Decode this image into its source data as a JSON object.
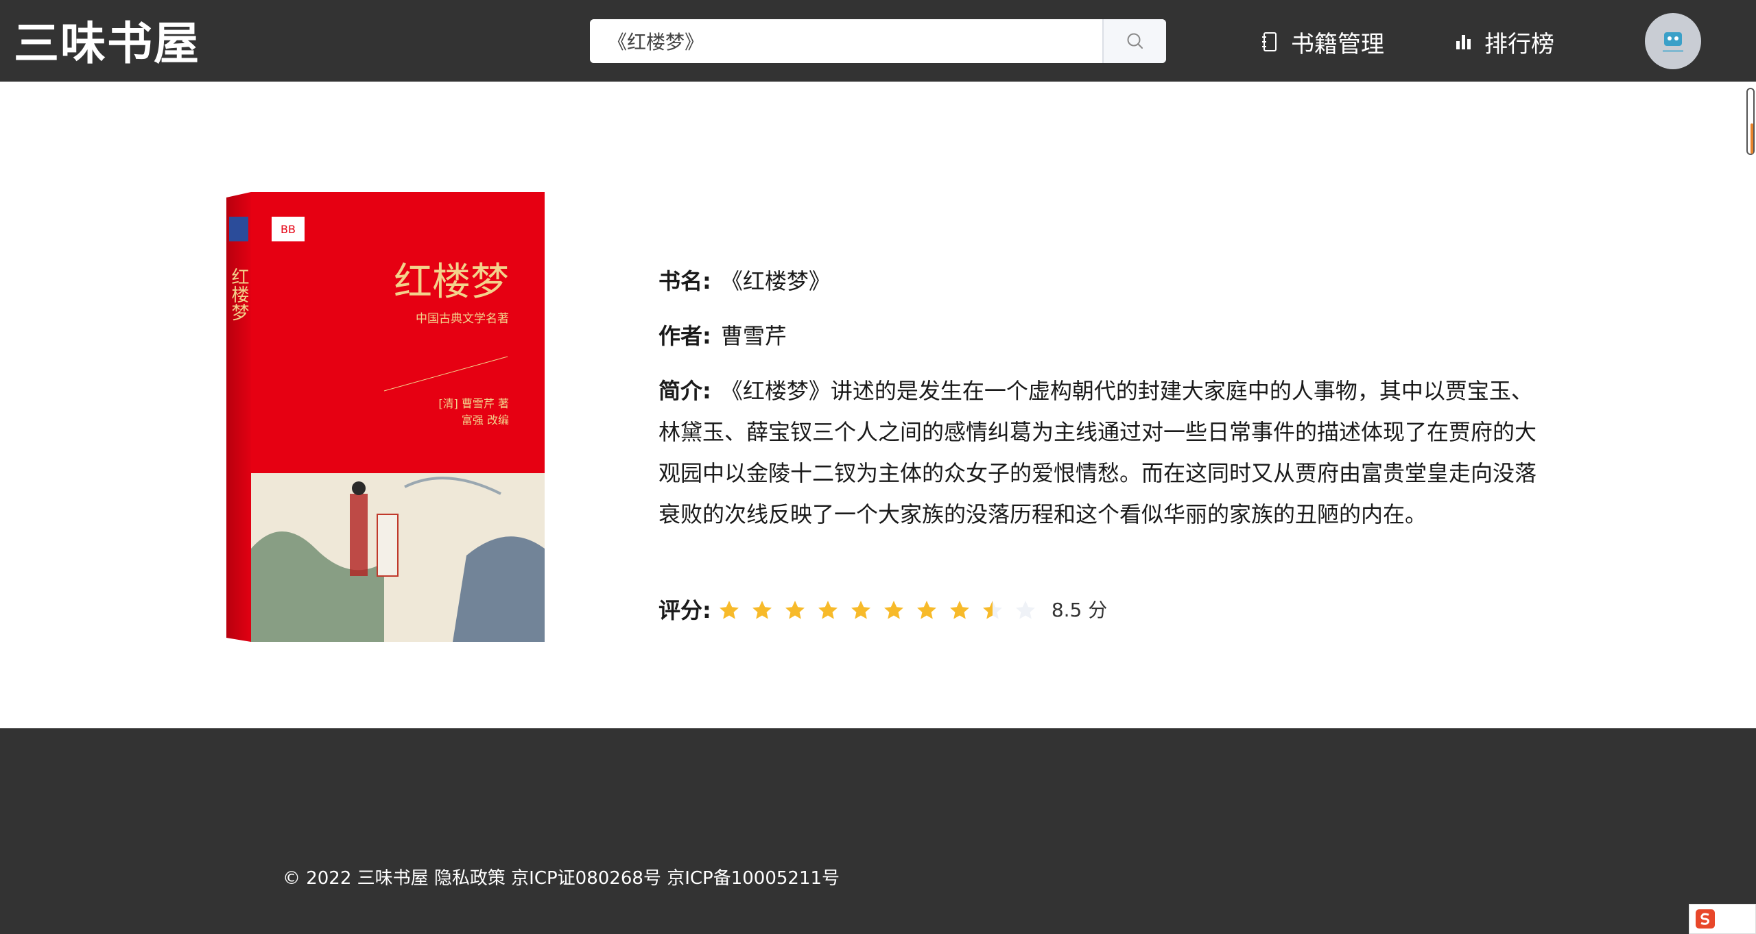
{
  "header": {
    "logo": "三味书屋",
    "search": {
      "value": "《红楼梦》",
      "placeholder": ""
    },
    "nav": [
      {
        "label": "书籍管理",
        "icon": "notebook-icon"
      },
      {
        "label": "排行榜",
        "icon": "bar-chart-icon"
      }
    ],
    "avatar_icon": "user-avatar-icon"
  },
  "book": {
    "title_label": "书名:",
    "title": "《红楼梦》",
    "author_label": "作者:",
    "author": "曹雪芹",
    "intro_label": "简介:",
    "intro": "《红楼梦》讲述的是发生在一个虚构朝代的封建大家庭中的人事物，其中以贾宝玉、林黛玉、薛宝钗三个人之间的感情纠葛为主线通过对一些日常事件的描述体现了在贾府的大观园中以金陵十二钗为主体的众女子的爱恨情愁。而在这同时又从贾府由富贵堂皇走向没落衰败的次线反映了一个大家族的没落历程和这个看似华丽的家族的丑陋的内在。",
    "score_label": "评分:",
    "score": 8.5,
    "score_max_stars": 10,
    "score_text": "8.5 分",
    "cover": {
      "title": "红楼梦",
      "subtitle": "中国古典文学名著",
      "author_line": "[清] 曹雪芹 著",
      "editor_line": "富强 改编",
      "badge": "BB"
    }
  },
  "footer": {
    "copyright": "© 2022 三味书屋 隐私政策 京ICP证080268号 京ICP备10005211号"
  },
  "colors": {
    "header_bg": "#333333",
    "footer_bg": "#333333",
    "star_on": "#f7ba2a",
    "star_off": "#eff2f7",
    "cover_red": "#e60012"
  }
}
